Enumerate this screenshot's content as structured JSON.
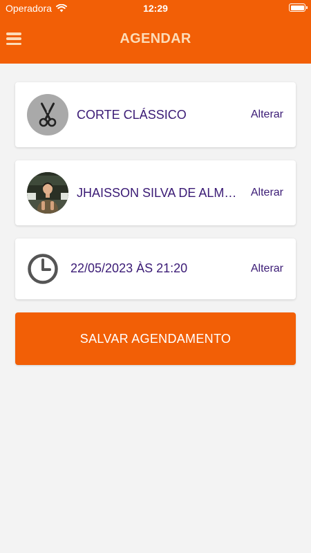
{
  "status_bar": {
    "carrier": "Operadora",
    "time": "12:29"
  },
  "header": {
    "title": "AGENDAR",
    "menu_icon": "hamburger-menu-icon"
  },
  "service": {
    "name": "CORTE CLÁSSICO",
    "change_label": "Alterar",
    "icon": "scissors-icon"
  },
  "professional": {
    "name": "JHAISSON SILVA DE ALMEIDA",
    "change_label": "Alterar"
  },
  "schedule": {
    "datetime": "22/05/2023 ÀS 21:20",
    "change_label": "Alterar",
    "icon": "clock-icon"
  },
  "actions": {
    "save_label": "SALVAR AGENDAMENTO"
  },
  "colors": {
    "primary": "#f25f06",
    "text_primary": "#3a1a75",
    "header_text": "#fcdcb8",
    "background": "#f3f3f3"
  }
}
